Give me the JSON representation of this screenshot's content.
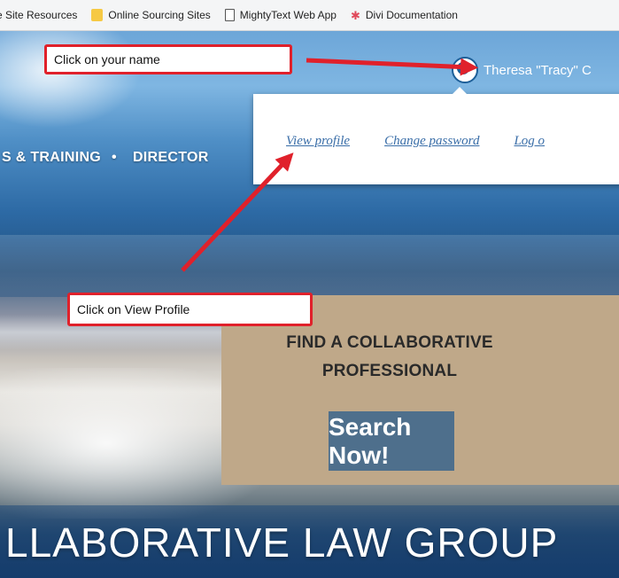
{
  "bookmarks": {
    "items": [
      {
        "label": "e Site Resources",
        "icon": "none"
      },
      {
        "label": "Online Sourcing Sites",
        "icon": "folder-icon"
      },
      {
        "label": "MightyText Web App",
        "icon": "document-icon"
      },
      {
        "label": "Divi Documentation",
        "icon": "star-icon"
      }
    ]
  },
  "header": {
    "user_name": "Theresa \"Tracy\" C",
    "nav": [
      "S & TRAINING",
      "DIRECTOR"
    ]
  },
  "dropdown": {
    "links": [
      "View profile",
      "Change password",
      "Log o"
    ]
  },
  "callouts": {
    "click_name": "Click on your name",
    "click_view_profile": "Click on View Profile"
  },
  "find_panel": {
    "title_line1": "FIND A COLLABORATIVE",
    "title_line2": "PROFESSIONAL",
    "button": "Search Now!"
  },
  "footer": {
    "group_name": "LLABORATIVE LAW GROUP"
  },
  "colors": {
    "callout_border": "#e0212b",
    "arrow": "#e0212b",
    "find_panel_bg": "#bfa889",
    "search_button_bg": "#4e6f8c",
    "link": "#3a6ea8"
  }
}
